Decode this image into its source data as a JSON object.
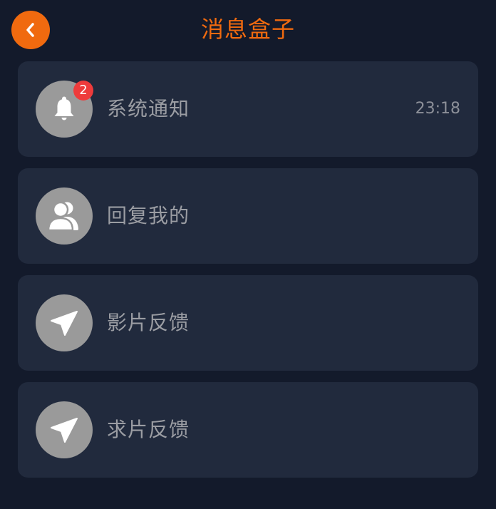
{
  "header": {
    "title": "消息盒子",
    "back_icon": "chevron-left-icon"
  },
  "colors": {
    "accent": "#f06a0f",
    "background": "#131a2b",
    "card": "#212a3d",
    "avatar": "#9a9a9a",
    "badge": "#ee3b3b"
  },
  "messages": [
    {
      "label": "系统通知",
      "icon": "bell-icon",
      "badge": "2",
      "time": "23:18"
    },
    {
      "label": "回复我的",
      "icon": "users-icon"
    },
    {
      "label": "影片反馈",
      "icon": "paper-plane-icon"
    },
    {
      "label": "求片反馈",
      "icon": "paper-plane-icon"
    }
  ]
}
